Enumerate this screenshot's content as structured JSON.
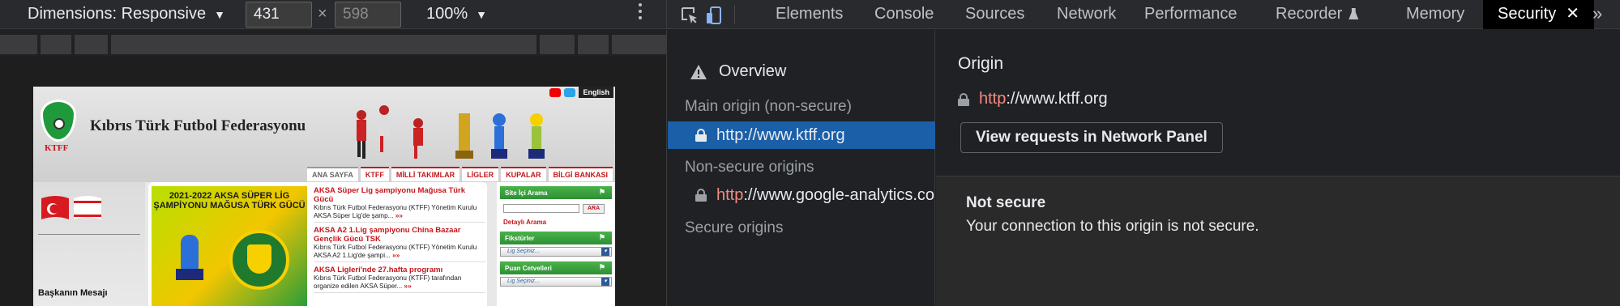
{
  "device_toolbar": {
    "dimensions_label": "Dimensions: Responsive",
    "width_value": "431",
    "height_placeholder": "598",
    "times": "×",
    "zoom_label": "100%"
  },
  "web_page": {
    "site_title": "Kıbrıs Türk Futbol Federasyonu",
    "crest_label": "KTFF",
    "english_label": "English",
    "nav": [
      "ANA SAYFA",
      "KTFF",
      "MİLLİ TAKIMLAR",
      "LİGLER",
      "KUPALAR",
      "BİLGİ BANKASI"
    ],
    "banner_title": "2021-2022 AKSA SÜPER LİG ŞAMPİYONU MAĞUSA TÜRK GÜCÜ",
    "news": [
      {
        "title": "AKSA Süper Lig şampiyonu Mağusa Türk Gücü",
        "text": "Kıbrıs Türk Futbol Federasyonu (KTFF) Yönetim Kurulu AKSA Süper Lig'de şamp...",
        "more": "»»"
      },
      {
        "title": "AKSA A2 1.Lig şampiyonu China Bazaar Gençlik Gücü TSK",
        "text": "Kıbrıs Türk Futbol Federasyonu (KTFF) Yönetim Kurulu AKSA A2 1.Lig'de şampi...",
        "more": "»»"
      },
      {
        "title": "AKSA Ligleri'nde 27.hafta programı",
        "text": "Kıbrıs Türk Futbol Federasyonu (KTFF) tarafından organize edilen AKSA Süper...",
        "more": "»»"
      }
    ],
    "side": {
      "search_title": "Site İçi Arama",
      "search_button": "ARA",
      "detailed_search": "Detaylı Arama",
      "fixtures_title": "Fikstürler",
      "standings_title": "Puan Cetvelleri",
      "league_select": "Lig Seçiniz..."
    },
    "president_message": "Başkanın Mesajı"
  },
  "devtools": {
    "tabs": [
      "Elements",
      "Console",
      "Sources",
      "Network",
      "Performance",
      "Recorder",
      "Memory",
      "Security"
    ],
    "active_tab": "Security",
    "close_glyph": "✕",
    "more_tabs_glyph": "»",
    "sidebar": {
      "overview": "Overview",
      "main_origin_heading": "Main origin (non-secure)",
      "main_origin_url": "http://www.ktff.org",
      "non_secure_heading": "Non-secure origins",
      "non_secure_scheme": "http",
      "non_secure_rest": "://www.google-analytics.com",
      "secure_heading": "Secure origins"
    },
    "main": {
      "origin_heading": "Origin",
      "origin_scheme": "http",
      "origin_rest": "://www.ktff.org",
      "view_requests_button": "View requests in Network Panel",
      "status_title": "Not secure",
      "status_desc": "Your connection to this origin is not secure."
    }
  },
  "colors": {
    "accent_selected": "#1a5fa8",
    "insecure_scheme": "#f28b82",
    "site_red": "#c4161c",
    "site_green": "#2e8f34"
  }
}
